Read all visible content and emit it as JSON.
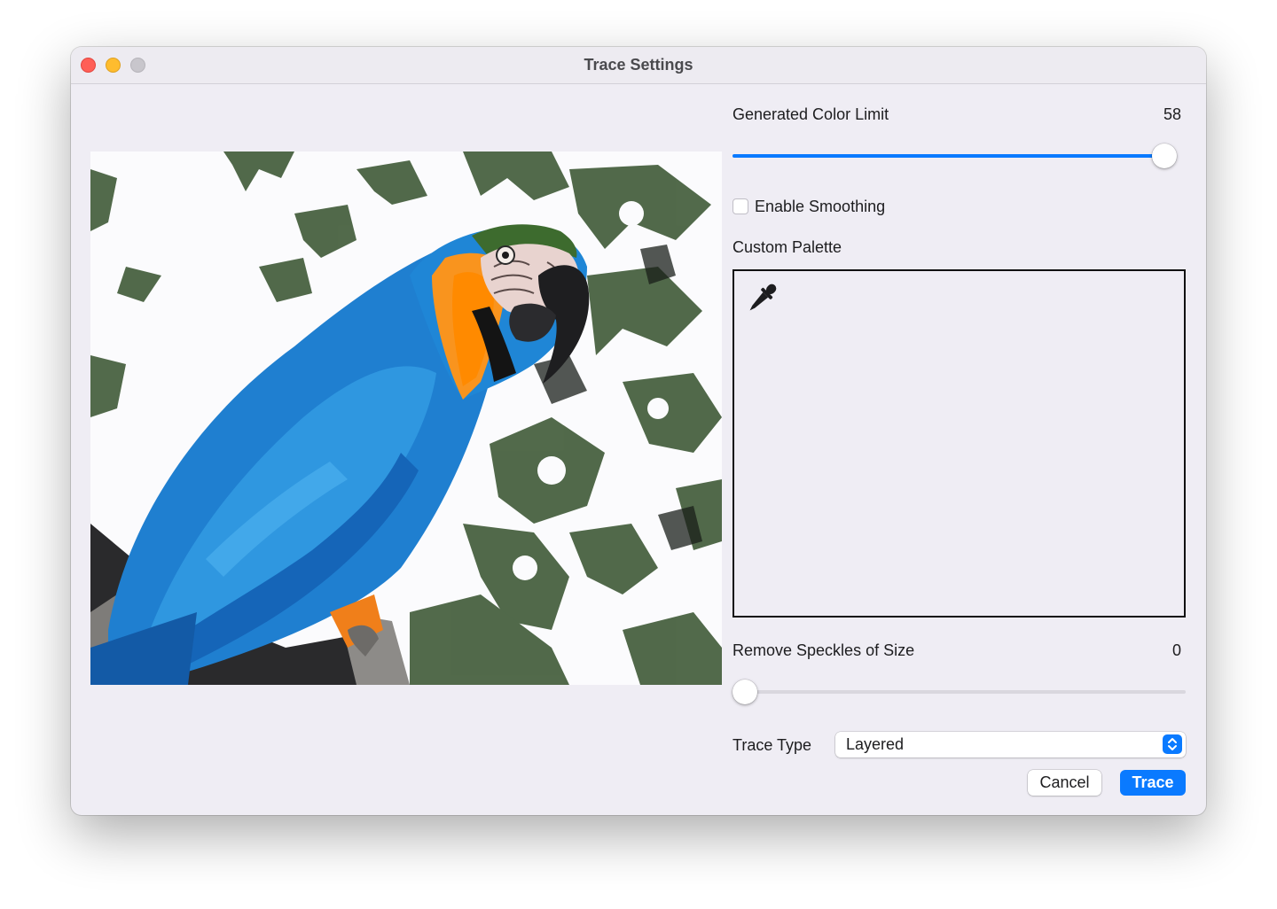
{
  "window": {
    "title": "Trace Settings"
  },
  "preview": {
    "image": "parrot-photo"
  },
  "color_limit": {
    "label": "Generated Color Limit",
    "value": "58",
    "fill_fraction": 0.98
  },
  "smoothing": {
    "label": "Enable Smoothing",
    "checked": false
  },
  "palette": {
    "label": "Custom Palette",
    "icon": "eyedropper-icon"
  },
  "speckles": {
    "label": "Remove Speckles of Size",
    "value": "0",
    "fill_fraction": 0.0
  },
  "trace_type": {
    "label": "Trace Type",
    "selected": "Layered"
  },
  "buttons": {
    "cancel": "Cancel",
    "trace": "Trace"
  },
  "colors": {
    "accent": "#0a7aff",
    "window_bg": "#efedf4"
  }
}
